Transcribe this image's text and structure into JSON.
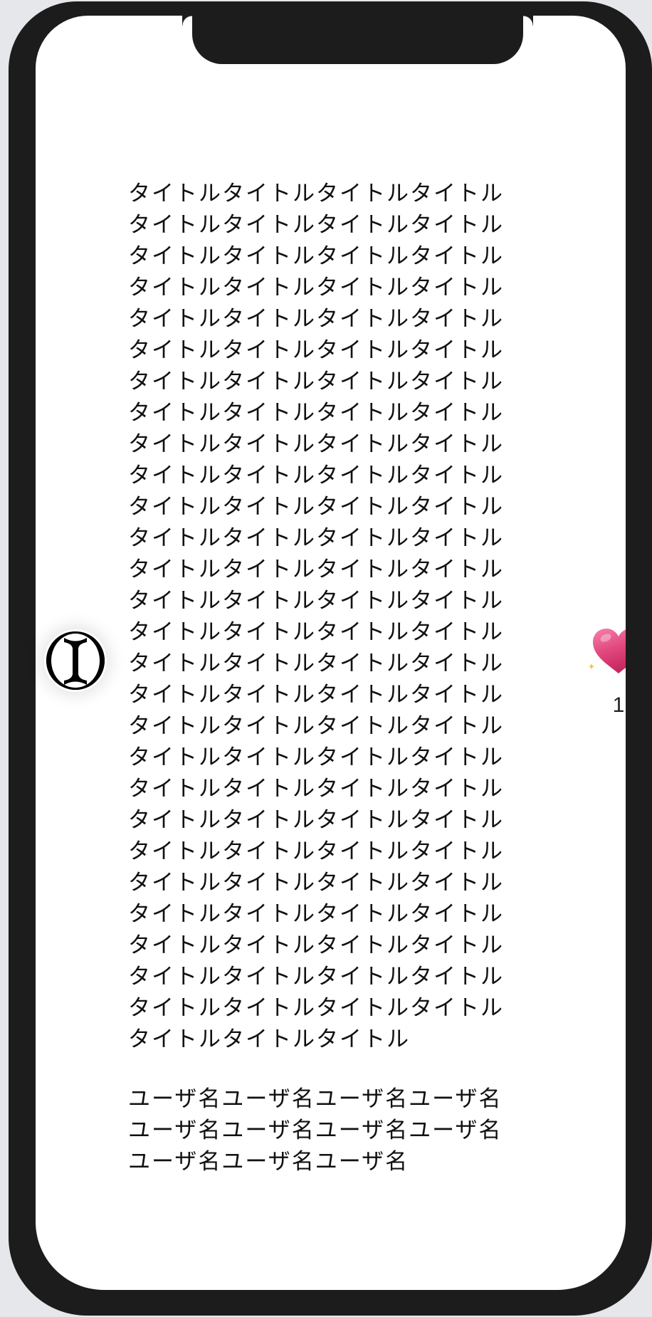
{
  "post": {
    "title": "タイトルタイトルタイトルタイトルタイトルタイトルタイトルタイトルタイトルタイトルタイトルタイトルタイトルタイトルタイトルタイトルタイトルタイトルタイトルタイトルタイトルタイトルタイトルタイトルタイトルタイトルタイトルタイトルタイトルタイトルタイトルタイトルタイトルタイトルタイトルタイトルタイトルタイトルタイトルタイトルタイトルタイトルタイトルタイトルタイトルタイトルタイトルタイトルタイトルタイトルタイトルタイトルタイトルタイトルタイトルタイトルタイトルタイトルタイトルタイトルタイトルタイトルタイトルタイトルタイトルタイトルタイトルタイトルタイトルタイトルタイトルタイトルタイトルタイトルタイトルタイトルタイトルタイトルタイトルタイトルタイトルタイトルタイトルタイトルタイトルタイトルタイトルタイトルタイトルタイトルタイトルタイトルタイトルタイトルタイトルタイトルタイトルタイトルタイトルタイトルタイトルタイトルタイトルタイトルタイトルタイトルタイトルタイトルタイトルタイトルタイトル",
    "user_name": "ユーザ名ユーザ名ユーザ名ユーザ名ユーザ名ユーザ名ユーザ名ユーザ名ユーザ名ユーザ名ユーザ名"
  },
  "like": {
    "count": "1",
    "icon": "sparkling-heart-icon",
    "heart_color": "#e0457b"
  },
  "side_handle": {
    "icon": "i-beam-icon"
  }
}
